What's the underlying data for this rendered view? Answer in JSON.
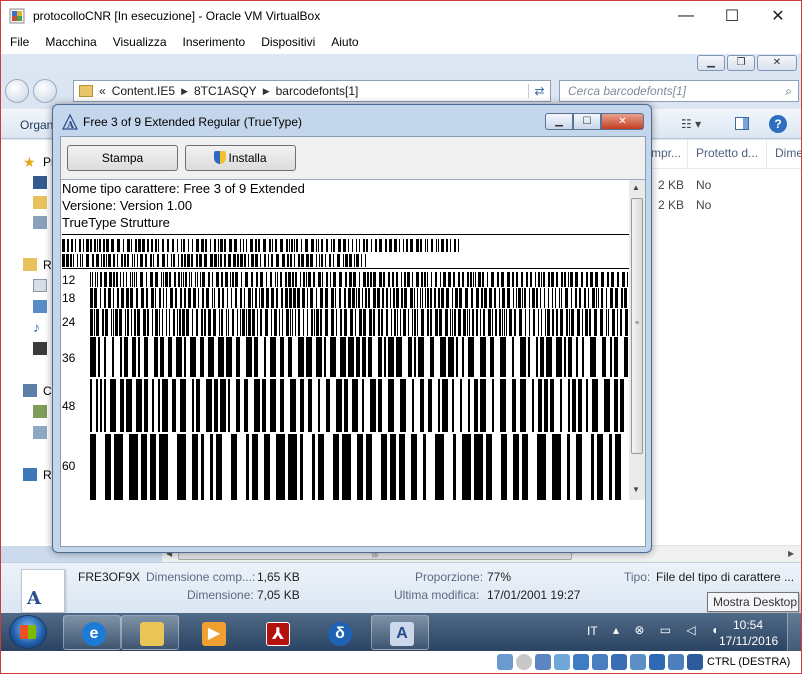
{
  "vbox": {
    "title": "protocolloCNR [In esecuzione] - Oracle VM VirtualBox",
    "menu": [
      "File",
      "Macchina",
      "Visualizza",
      "Inserimento",
      "Dispositivi",
      "Aiuto"
    ],
    "host_key": "CTRL (DESTRA)"
  },
  "explorer": {
    "address": {
      "prefix": "«",
      "segments": [
        "Content.IE5",
        "8TC1ASQY",
        "barcodefonts[1]"
      ]
    },
    "search_placeholder": "Cerca barcodefonts[1]",
    "toolbar": {
      "organize": "Organ"
    },
    "nav": {
      "favorites": "Pr",
      "libraries": "Ra",
      "computer": "C",
      "network": "Re"
    },
    "columns": {
      "compressed": "mpr...",
      "protected": "Protetto d...",
      "dimension": "Dime"
    },
    "rows": [
      {
        "size": "2 KB",
        "protected": "No"
      },
      {
        "size": "2 KB",
        "protected": "No"
      }
    ],
    "details": {
      "icon_letter": "A",
      "filename": "FRE3OF9X",
      "compressed_label": "Dimensione comp...:",
      "compressed_value": "1,65 KB",
      "size_label": "Dimensione:",
      "size_value": "7,05 KB",
      "ratio_label": "Proporzione:",
      "ratio_value": "77%",
      "modified_label": "Ultima modifica:",
      "modified_value": "17/01/2001 19:27",
      "type_label": "Tipo:",
      "type_value": "File del tipo di carattere ..."
    },
    "tooltip": "Mostra Desktop"
  },
  "font_dialog": {
    "title": "Free 3 of 9 Extended Regular (TrueType)",
    "print_label": "Stampa",
    "install_label": "Installa",
    "font_name": "Nome tipo carattere: Free 3 of 9 Extended",
    "version": "Versione: Version 1.00",
    "type": "TrueType Strutture",
    "sizes": [
      "12",
      "18",
      "24",
      "36",
      "48",
      "60"
    ]
  },
  "taskbar": {
    "language": "IT",
    "time": "10:54",
    "date": "17/11/2016",
    "apps": [
      "internet-explorer",
      "windows-explorer",
      "media-player",
      "acrobat-reader",
      "delta-app",
      "font-viewer"
    ]
  }
}
